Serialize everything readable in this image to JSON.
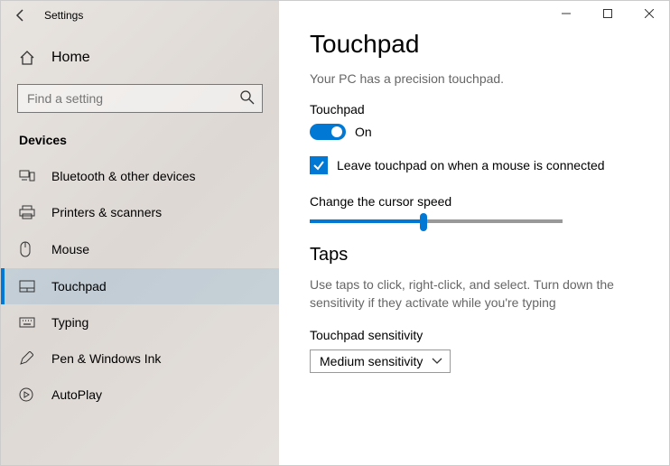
{
  "window": {
    "title": "Settings"
  },
  "home_label": "Home",
  "search": {
    "placeholder": "Find a setting"
  },
  "category": "Devices",
  "nav": [
    {
      "label": "Bluetooth & other devices"
    },
    {
      "label": "Printers & scanners"
    },
    {
      "label": "Mouse"
    },
    {
      "label": "Touchpad"
    },
    {
      "label": "Typing"
    },
    {
      "label": "Pen & Windows Ink"
    },
    {
      "label": "AutoPlay"
    }
  ],
  "page": {
    "heading": "Touchpad",
    "subtitle": "Your PC has a precision touchpad.",
    "toggle_label": "Touchpad",
    "toggle_state": "On",
    "checkbox_label": "Leave touchpad on when a mouse is connected",
    "cursor_speed_label": "Change the cursor speed",
    "taps_heading": "Taps",
    "taps_desc": "Use taps to click, right-click, and select. Turn down the sensitivity if they activate while you're typing",
    "sens_label": "Touchpad sensitivity",
    "sens_value": "Medium sensitivity"
  }
}
